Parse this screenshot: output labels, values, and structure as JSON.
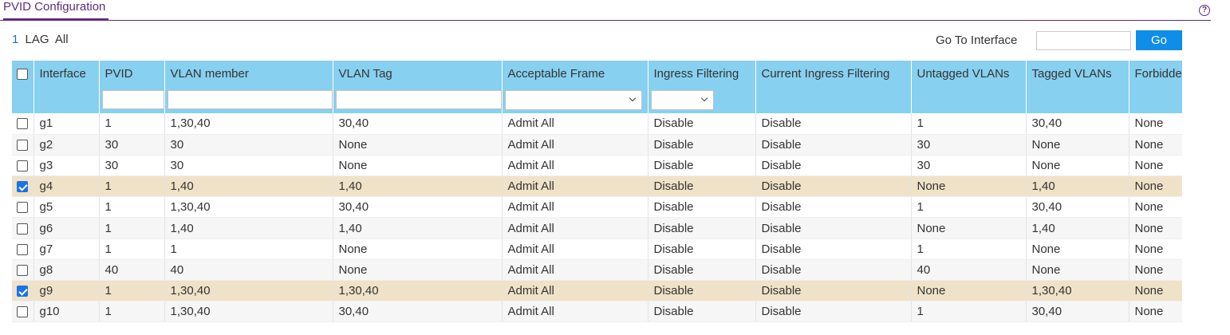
{
  "page": {
    "tab_title": "PVID Configuration",
    "help_icon": "?"
  },
  "filters": {
    "one": "1",
    "lag": "LAG",
    "all": "All"
  },
  "goto": {
    "label": "Go To Interface",
    "value": "",
    "button": "Go"
  },
  "table": {
    "headers": [
      "Interface",
      "PVID",
      "VLAN member",
      "VLAN Tag",
      "Acceptable Frame",
      "Ingress Filtering",
      "Current Ingress Filtering",
      "Untagged VLANs",
      "Tagged VLANs",
      "Forbidden VLANs"
    ],
    "rows": [
      {
        "checked": false,
        "cells": [
          "g1",
          "1",
          "1,30,40",
          "30,40",
          "Admit All",
          "Disable",
          "Disable",
          "1",
          "30,40",
          "None"
        ]
      },
      {
        "checked": false,
        "cells": [
          "g2",
          "30",
          "30",
          "None",
          "Admit All",
          "Disable",
          "Disable",
          "30",
          "None",
          "None"
        ]
      },
      {
        "checked": false,
        "cells": [
          "g3",
          "30",
          "30",
          "None",
          "Admit All",
          "Disable",
          "Disable",
          "30",
          "None",
          "None"
        ]
      },
      {
        "checked": true,
        "cells": [
          "g4",
          "1",
          "1,40",
          "1,40",
          "Admit All",
          "Disable",
          "Disable",
          "None",
          "1,40",
          "None"
        ]
      },
      {
        "checked": false,
        "cells": [
          "g5",
          "1",
          "1,30,40",
          "30,40",
          "Admit All",
          "Disable",
          "Disable",
          "1",
          "30,40",
          "None"
        ]
      },
      {
        "checked": false,
        "cells": [
          "g6",
          "1",
          "1,40",
          "1,40",
          "Admit All",
          "Disable",
          "Disable",
          "None",
          "1,40",
          "None"
        ]
      },
      {
        "checked": false,
        "cells": [
          "g7",
          "1",
          "1",
          "None",
          "Admit All",
          "Disable",
          "Disable",
          "1",
          "None",
          "None"
        ]
      },
      {
        "checked": false,
        "cells": [
          "g8",
          "40",
          "40",
          "None",
          "Admit All",
          "Disable",
          "Disable",
          "40",
          "None",
          "None"
        ]
      },
      {
        "checked": true,
        "cells": [
          "g9",
          "1",
          "1,30,40",
          "1,30,40",
          "Admit All",
          "Disable",
          "Disable",
          "None",
          "1,30,40",
          "None"
        ]
      },
      {
        "checked": false,
        "cells": [
          "g10",
          "1",
          "1,30,40",
          "30,40",
          "Admit All",
          "Disable",
          "Disable",
          "1",
          "30,40",
          "None"
        ]
      }
    ]
  },
  "colors": {
    "accent": "#5c2d82",
    "header_bg": "#87d0f0",
    "selected_row": "#f0e2c8",
    "button": "#0e8ee8"
  }
}
